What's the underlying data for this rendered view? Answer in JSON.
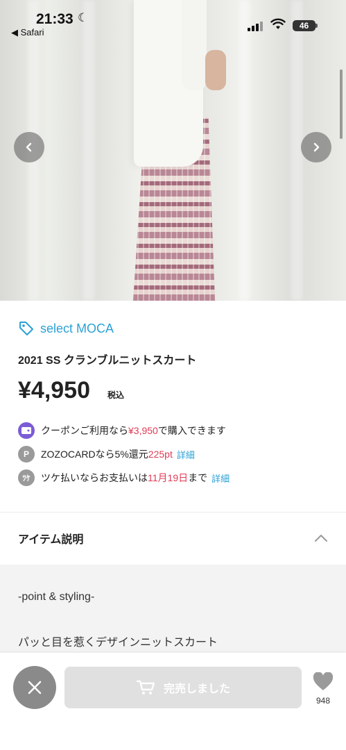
{
  "status_bar": {
    "time": "21:33",
    "back_app": "◀ Safari",
    "battery": "46"
  },
  "brand": {
    "name": "select MOCA",
    "color": "#2ba1d6"
  },
  "product": {
    "title": "2021 SS クランブルニットスカート",
    "price": "¥4,950",
    "tax_label": "税込"
  },
  "promos": [
    {
      "icon": "coupon-icon",
      "text_before": "クーポンご利用なら",
      "highlight": "¥3,950",
      "text_after": "で購入できます",
      "link": ""
    },
    {
      "icon": "zozocard-p-icon",
      "text_before": "ZOZOCARDなら5%還元 ",
      "highlight": "225pt",
      "text_after": "",
      "link": "詳細"
    },
    {
      "icon": "tsuke-payment-icon",
      "text_before": "ツケ払いならお支払いは",
      "highlight": "11月19日",
      "text_after": "まで",
      "link": "詳細"
    }
  ],
  "section": {
    "title": "アイテム説明"
  },
  "description": {
    "line1": "-point & styling-",
    "line2": "パッと目を惹くデザインニットスカート"
  },
  "bottom_bar": {
    "soldout_label": "完売しました",
    "favorite_count": "948"
  },
  "colors": {
    "accent": "#2ba1d6",
    "sale_red": "#e13a55",
    "coupon_purple": "#7b5cd6"
  }
}
